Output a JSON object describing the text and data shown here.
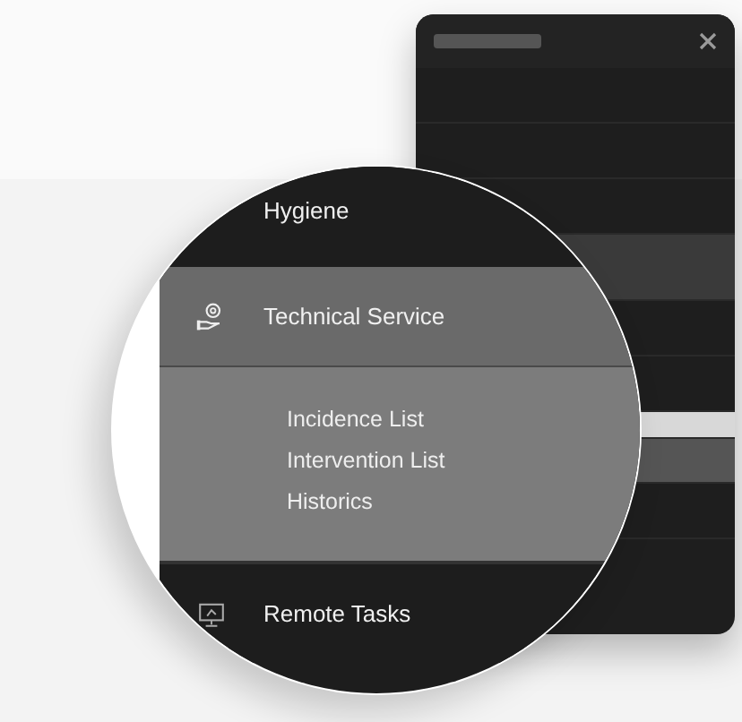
{
  "magnifier": {
    "items": [
      {
        "label": "Hygiene",
        "selected": false
      },
      {
        "label": "Technical Service",
        "selected": true,
        "children": [
          {
            "label": "Incidence List"
          },
          {
            "label": "Intervention List"
          },
          {
            "label": "Historics"
          }
        ]
      },
      {
        "label": "Remote Tasks",
        "selected": false
      }
    ]
  }
}
